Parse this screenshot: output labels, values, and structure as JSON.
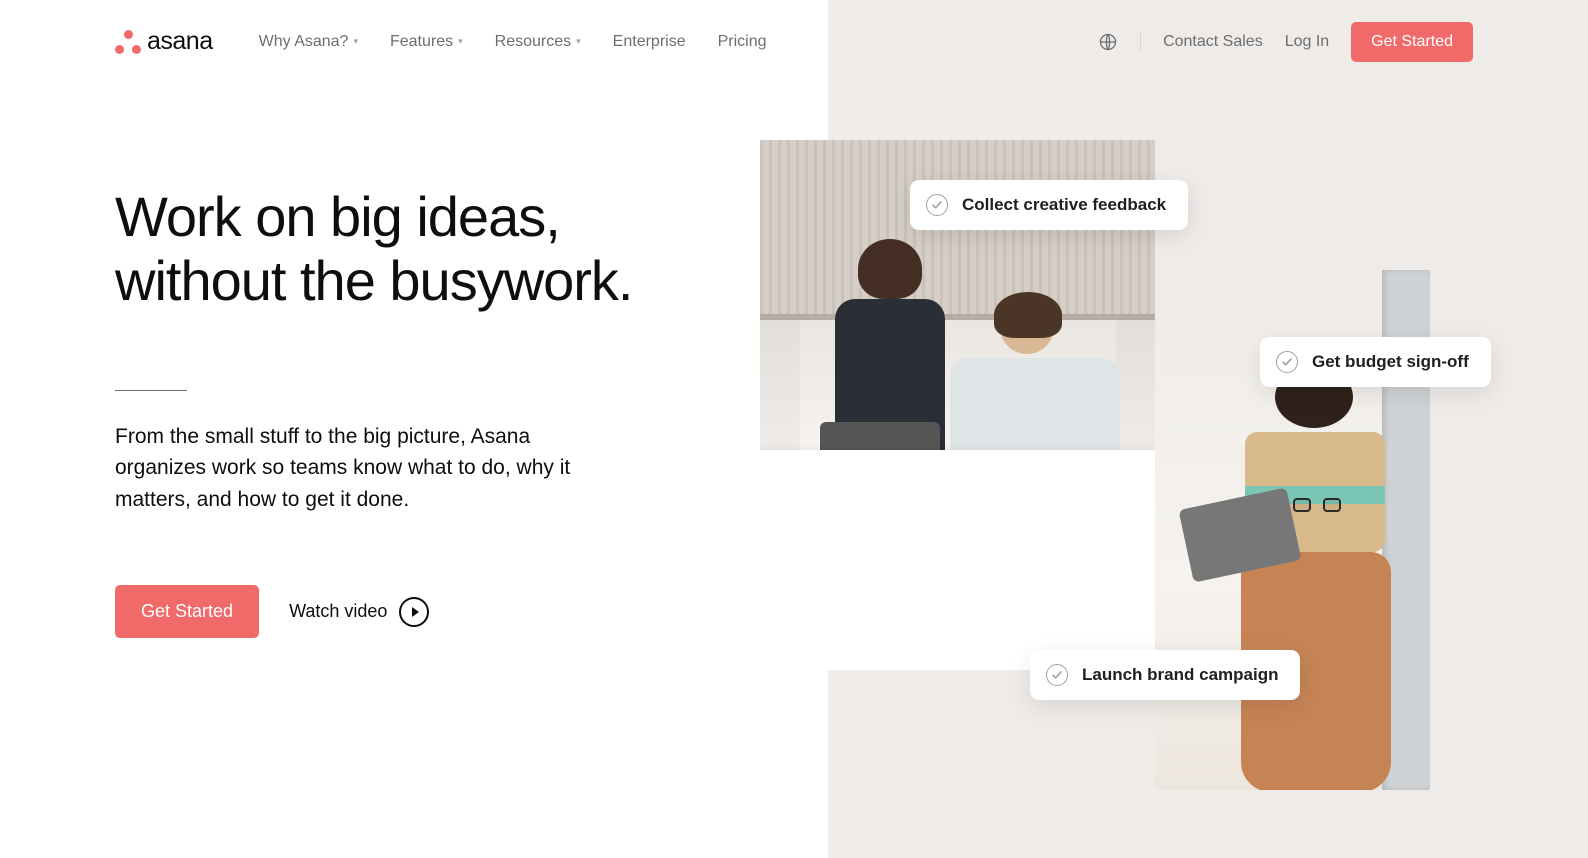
{
  "brand": {
    "name": "asana"
  },
  "nav": {
    "items": [
      {
        "label": "Why Asana?",
        "has_dropdown": true
      },
      {
        "label": "Features",
        "has_dropdown": true
      },
      {
        "label": "Resources",
        "has_dropdown": true
      },
      {
        "label": "Enterprise",
        "has_dropdown": false
      },
      {
        "label": "Pricing",
        "has_dropdown": false
      }
    ]
  },
  "header_right": {
    "contact": "Contact Sales",
    "login": "Log In",
    "cta": "Get Started"
  },
  "hero": {
    "title_line1": "Work on big ideas,",
    "title_line2": "without the busywork.",
    "description": "From the small stuff to the big picture, Asana organizes work so teams know what to do, why it matters, and how to get it done.",
    "cta": "Get Started",
    "watch": "Watch video"
  },
  "pills": {
    "p1": "Collect creative feedback",
    "p2": "Get budget sign-off",
    "p3": "Launch brand campaign"
  }
}
